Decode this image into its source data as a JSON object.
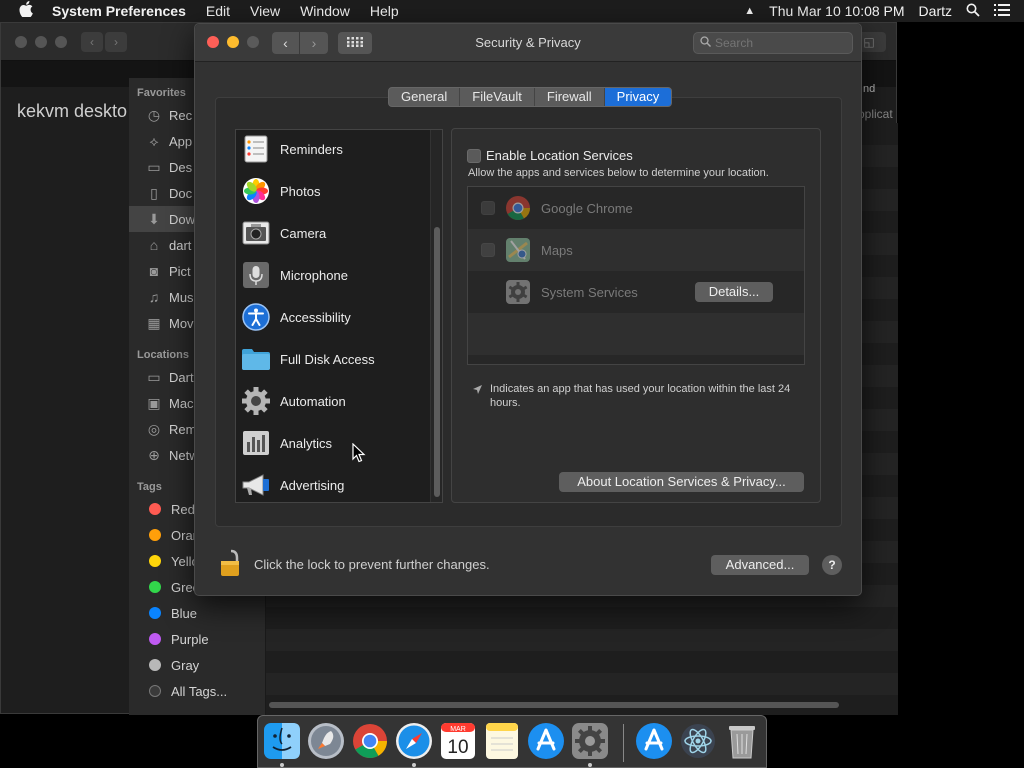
{
  "menubar": {
    "apple": "",
    "app_name": "System Preferences",
    "menus": [
      "Edit",
      "View",
      "Window",
      "Help"
    ],
    "clock": "Thu Mar 10  10:08 PM",
    "user": "Dartz"
  },
  "finder": {
    "title": "kekvm deskto",
    "col_header": "nd",
    "col_header2": "oplicat",
    "sidebar": {
      "favorites_label": "Favorites",
      "favorites": [
        "Rec",
        "App",
        "Des",
        "Doc",
        "Dow",
        "dart",
        "Pict",
        "Mus",
        "Mov"
      ],
      "locations_label": "Locations",
      "locations": [
        "Dart",
        "Mac",
        "Rem",
        "Netw"
      ],
      "tags_label": "Tags",
      "tags": [
        {
          "name": "Red",
          "color": "#ff5b52"
        },
        {
          "name": "Oran",
          "color": "#ff9f0a"
        },
        {
          "name": "Yello",
          "color": "#ffd60a"
        },
        {
          "name": "Gree",
          "color": "#32d74b"
        },
        {
          "name": "Blue",
          "color": "#0a84ff"
        },
        {
          "name": "Purple",
          "color": "#bf5af2"
        },
        {
          "name": "Gray",
          "color": "#b8b8b8"
        },
        {
          "name": "All Tags...",
          "color": "#555555"
        }
      ]
    }
  },
  "prefs": {
    "title": "Security & Privacy",
    "search_placeholder": "Search",
    "tabs": [
      "General",
      "FileVault",
      "Firewall",
      "Privacy"
    ],
    "active_tab": "Privacy",
    "privacy_list": [
      "Reminders",
      "Photos",
      "Camera",
      "Microphone",
      "Accessibility",
      "Full Disk Access",
      "Automation",
      "Analytics",
      "Advertising"
    ],
    "enable_location_label": "Enable Location Services",
    "allow_text": "Allow the apps and services below to determine your location.",
    "apps": [
      "Google Chrome",
      "Maps",
      "System Services"
    ],
    "details_button": "Details...",
    "indicator_text": "Indicates an app that has used your location within the last 24 hours.",
    "about_button": "About Location Services & Privacy...",
    "lock_text": "Click the lock to prevent further changes.",
    "advanced_button": "Advanced...",
    "help_button": "?"
  },
  "dock": {
    "calendar_month": "MAR",
    "calendar_day": "10"
  },
  "colors": {
    "accent": "#1c6ed8",
    "close": "#fe5f57",
    "minimize": "#febc2e"
  }
}
